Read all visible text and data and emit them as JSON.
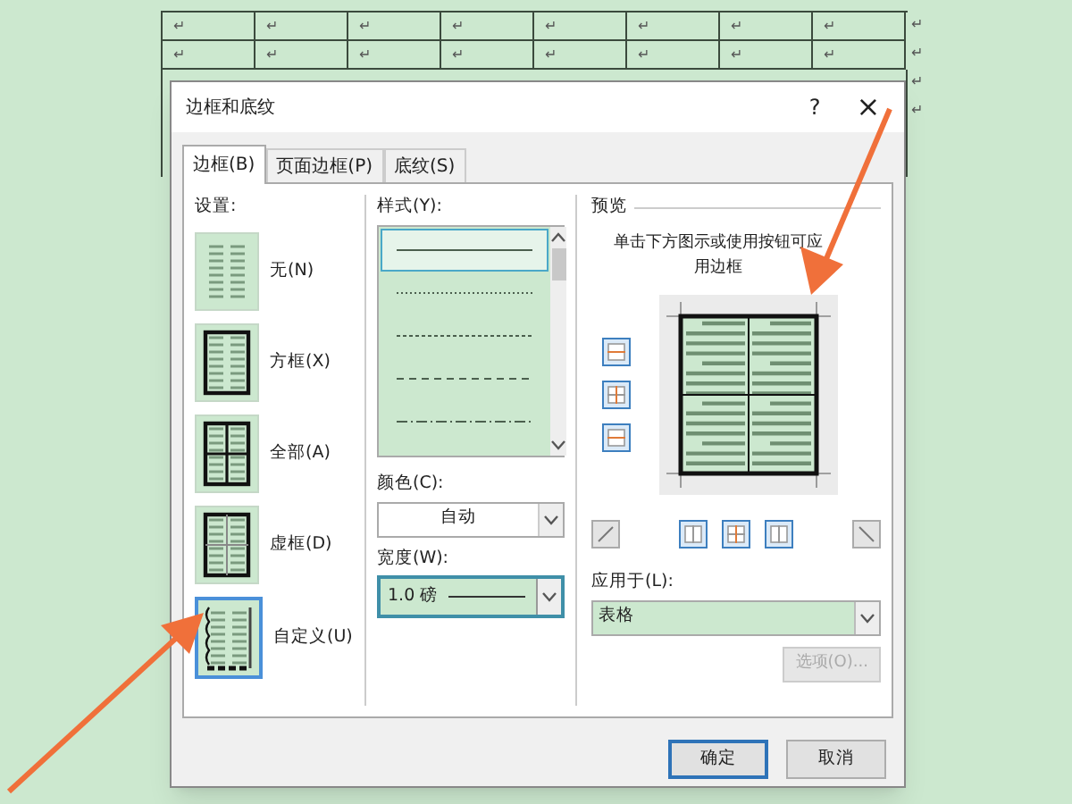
{
  "document_table": {
    "rows": [
      [
        "↵",
        "↵",
        "↵",
        "↵",
        "↵",
        "↵",
        "↵",
        "↵"
      ],
      [
        "↵",
        "↵",
        "↵",
        "↵",
        "↵",
        "↵",
        "↵",
        "↵"
      ]
    ],
    "row_end_marks": [
      "↵",
      "↵",
      "↵",
      "↵"
    ]
  },
  "dialog": {
    "title": "边框和底纹",
    "help": "?",
    "close": "×",
    "tabs": [
      {
        "label": "边框(B)",
        "selected": true
      },
      {
        "label": "页面边框(P)",
        "selected": false
      },
      {
        "label": "底纹(S)",
        "selected": false
      }
    ],
    "settings": {
      "label": "设置:",
      "items": [
        {
          "label": "无(N)",
          "kind": "none",
          "selected": false
        },
        {
          "label": "方框(X)",
          "kind": "box",
          "selected": false
        },
        {
          "label": "全部(A)",
          "kind": "all",
          "selected": false
        },
        {
          "label": "虚框(D)",
          "kind": "grid",
          "selected": false
        },
        {
          "label": "自定义(U)",
          "kind": "custom",
          "selected": true
        }
      ]
    },
    "style": {
      "label": "样式(Y):",
      "items": [
        {
          "kind": "solid",
          "selected": true
        },
        {
          "kind": "dotted",
          "selected": false
        },
        {
          "kind": "fine-dash",
          "selected": false
        },
        {
          "kind": "dash",
          "selected": false
        },
        {
          "kind": "dash-dot",
          "selected": false
        }
      ]
    },
    "color": {
      "label": "颜色(C):",
      "value": "自动"
    },
    "width": {
      "label": "宽度(W):",
      "value": "1.0 磅"
    },
    "preview": {
      "label": "预览",
      "hint": "单击下方图示或使用按钮可应用边框"
    },
    "apply_to": {
      "label": "应用于(L):",
      "value": "表格"
    },
    "options_button": {
      "label": "选项(O)...",
      "disabled": true
    },
    "buttons": [
      {
        "label": "确定",
        "kind": "primary"
      },
      {
        "label": "取消",
        "kind": "normal"
      }
    ]
  }
}
